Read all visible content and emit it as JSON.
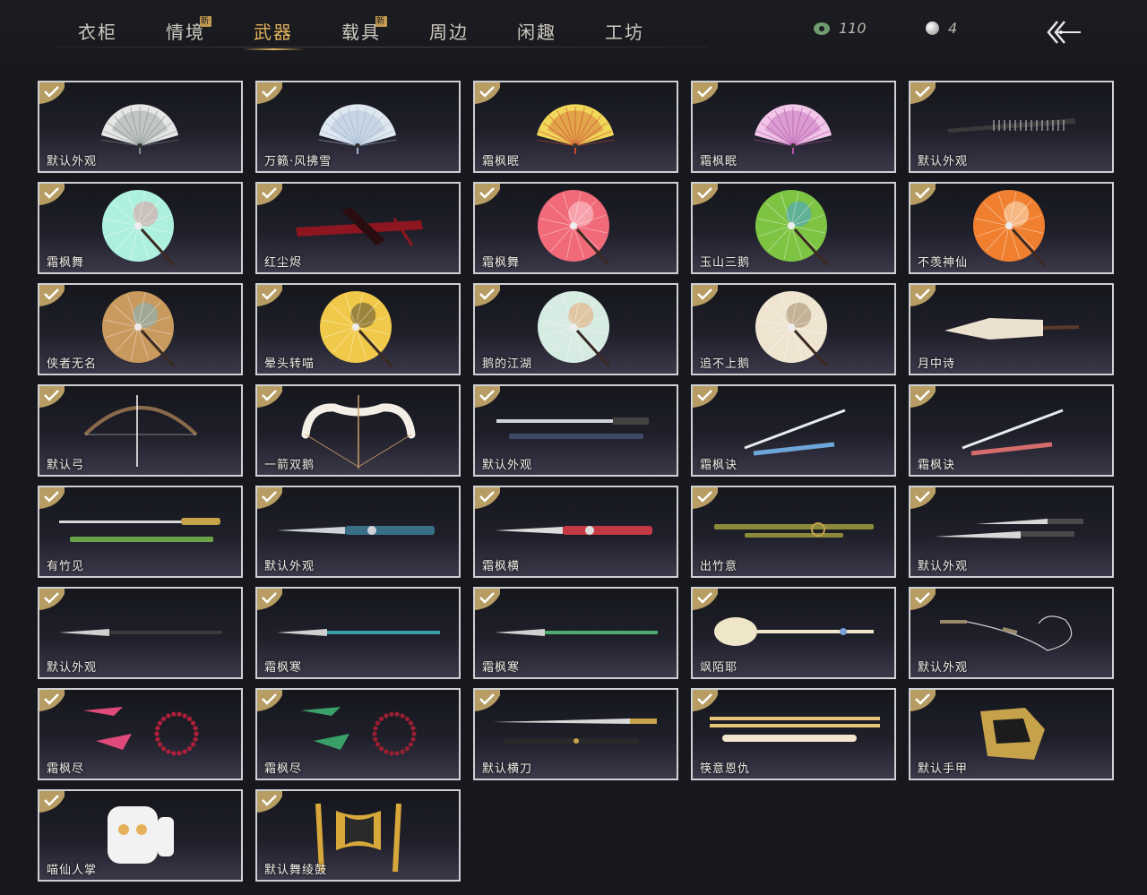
{
  "tabs": [
    {
      "label": "衣柜",
      "is_new": false,
      "active": false
    },
    {
      "label": "情境",
      "is_new": true,
      "active": false
    },
    {
      "label": "武器",
      "is_new": false,
      "active": true
    },
    {
      "label": "载具",
      "is_new": true,
      "active": false
    },
    {
      "label": "周边",
      "is_new": false,
      "active": false
    },
    {
      "label": "闲趣",
      "is_new": false,
      "active": false
    },
    {
      "label": "工坊",
      "is_new": false,
      "active": false
    }
  ],
  "new_badge": "新",
  "currency": {
    "jade": "110",
    "pearl": "4"
  },
  "colors": {
    "accent": "#e2b25c",
    "card_border": "#cfd0d3",
    "check_badge": "#b79d63",
    "background": "#16181d"
  },
  "items": [
    {
      "name": "默认外观",
      "icon": "fan-icon",
      "kind": "fan",
      "colors": [
        "#e6e6e6",
        "#7c8a86"
      ]
    },
    {
      "name": "万籁·风拂雪",
      "icon": "fan-icon",
      "kind": "fan",
      "colors": [
        "#dfe7f0",
        "#9db4cf"
      ]
    },
    {
      "name": "霜枫眠",
      "icon": "fan-icon",
      "kind": "fan",
      "colors": [
        "#f0d75a",
        "#c9482e"
      ]
    },
    {
      "name": "霜枫眠",
      "icon": "fan-icon",
      "kind": "fan",
      "colors": [
        "#f1c6e8",
        "#b04ea6"
      ]
    },
    {
      "name": "默认外观",
      "icon": "closed-fan-icon",
      "kind": "closedfan",
      "colors": [
        "#cfcfcf",
        "#3a3a3a"
      ]
    },
    {
      "name": "霜枫舞",
      "icon": "umbrella-icon",
      "kind": "umbrella",
      "colors": [
        "#aef0de",
        "#e39aa0"
      ]
    },
    {
      "name": "红尘烬",
      "icon": "red-umbrella-icon",
      "kind": "redbundle",
      "colors": [
        "#8e1620",
        "#2a0d10"
      ]
    },
    {
      "name": "霜枫舞",
      "icon": "umbrella-icon",
      "kind": "umbrella",
      "colors": [
        "#f06a7a",
        "#ffd0d6"
      ]
    },
    {
      "name": "玉山三鹅",
      "icon": "umbrella-icon",
      "kind": "umbrella",
      "colors": [
        "#7dc443",
        "#4ba3d8"
      ]
    },
    {
      "name": "不羡神仙",
      "icon": "umbrella-icon",
      "kind": "umbrella",
      "colors": [
        "#f08030",
        "#fbe5c8"
      ]
    },
    {
      "name": "侠者无名",
      "icon": "umbrella-icon",
      "kind": "umbrella",
      "colors": [
        "#c99a5e",
        "#7fb5c2"
      ]
    },
    {
      "name": "晕头转喵",
      "icon": "umbrella-icon",
      "kind": "umbrella",
      "colors": [
        "#f0c94a",
        "#5a4a33"
      ]
    },
    {
      "name": "鹅的江湖",
      "icon": "umbrella-icon",
      "kind": "umbrella",
      "colors": [
        "#d6ebe2",
        "#e8a66b"
      ]
    },
    {
      "name": "追不上鹅",
      "icon": "umbrella-icon",
      "kind": "umbrella",
      "colors": [
        "#efe4d0",
        "#a18866"
      ]
    },
    {
      "name": "月中诗",
      "icon": "closed-umbrella-icon",
      "kind": "closedumbrella",
      "colors": [
        "#ece1cf",
        "#5a3a2a"
      ]
    },
    {
      "name": "默认弓",
      "icon": "bow-icon",
      "kind": "bow",
      "colors": [
        "#8a6a4a",
        "#ffffff"
      ]
    },
    {
      "name": "一箭双鹅",
      "icon": "bow-icon",
      "kind": "bow2",
      "colors": [
        "#f4efe6",
        "#c8a064"
      ]
    },
    {
      "name": "默认外观",
      "icon": "sword-icon",
      "kind": "swords",
      "colors": [
        "#cfd3d8",
        "#3d4a66"
      ]
    },
    {
      "name": "霜枫诀",
      "icon": "sword-icon",
      "kind": "sword",
      "colors": [
        "#e7ebef",
        "#6ea6d9"
      ]
    },
    {
      "name": "霜枫诀",
      "icon": "sword-icon",
      "kind": "sword",
      "colors": [
        "#e7ebef",
        "#d56d6d"
      ]
    },
    {
      "name": "有竹见",
      "icon": "sword-icon",
      "kind": "bamboosword",
      "colors": [
        "#d9d9d9",
        "#6aa247"
      ]
    },
    {
      "name": "默认外观",
      "icon": "sword-icon",
      "kind": "dblade",
      "colors": [
        "#cfd3d8",
        "#3a6f8a"
      ]
    },
    {
      "name": "霜枫横",
      "icon": "blade-icon",
      "kind": "dblade",
      "colors": [
        "#dcdcdc",
        "#c33a45"
      ]
    },
    {
      "name": "出竹意",
      "icon": "bamboo-icon",
      "kind": "bamboo",
      "colors": [
        "#8a8a3a",
        "#c6a24a"
      ]
    },
    {
      "name": "默认外观",
      "icon": "dual-blade-icon",
      "kind": "dualblade",
      "colors": [
        "#d8d8d8",
        "#4a4a4a"
      ]
    },
    {
      "name": "默认外观",
      "icon": "spear-icon",
      "kind": "spear",
      "colors": [
        "#cfcfcf",
        "#3a3a3a"
      ]
    },
    {
      "name": "霜枫寒",
      "icon": "spear-icon",
      "kind": "spear",
      "colors": [
        "#cfcfcf",
        "#3aa0a8"
      ]
    },
    {
      "name": "霜枫寒",
      "icon": "spear-icon",
      "kind": "spear",
      "colors": [
        "#cfcfcf",
        "#4caa6a"
      ]
    },
    {
      "name": "飒陌耶",
      "icon": "staff-icon",
      "kind": "staff",
      "colors": [
        "#efe5c8",
        "#7aa0d8"
      ]
    },
    {
      "name": "默认外观",
      "icon": "rope-dart-icon",
      "kind": "ropedart",
      "colors": [
        "#9a8a6a",
        "#cfcfcf"
      ]
    },
    {
      "name": "霜枫尽",
      "icon": "rope-dart-icon",
      "kind": "beads",
      "colors": [
        "#e04a7a",
        "#b0203a"
      ]
    },
    {
      "name": "霜枫尽",
      "icon": "rope-dart-icon",
      "kind": "beads",
      "colors": [
        "#3aa06a",
        "#9a1f32"
      ]
    },
    {
      "name": "默认横刀",
      "icon": "saber-icon",
      "kind": "saber",
      "colors": [
        "#d8d8d8",
        "#c6a24a"
      ]
    },
    {
      "name": "筷意恩仇",
      "icon": "chopsticks-icon",
      "kind": "chopsticks",
      "colors": [
        "#e6c478",
        "#f2e6cf"
      ]
    },
    {
      "name": "默认手甲",
      "icon": "gauntlet-icon",
      "kind": "gauntlet",
      "colors": [
        "#c6a24a",
        "#1c1c1c"
      ]
    },
    {
      "name": "喵仙人掌",
      "icon": "cat-paw-icon",
      "kind": "catpaw",
      "colors": [
        "#f2f2f2",
        "#e6b05a"
      ]
    },
    {
      "name": "默认舞绫鼓",
      "icon": "drum-icon",
      "kind": "drum",
      "colors": [
        "#d8a83a",
        "#2a2a2a"
      ]
    }
  ]
}
